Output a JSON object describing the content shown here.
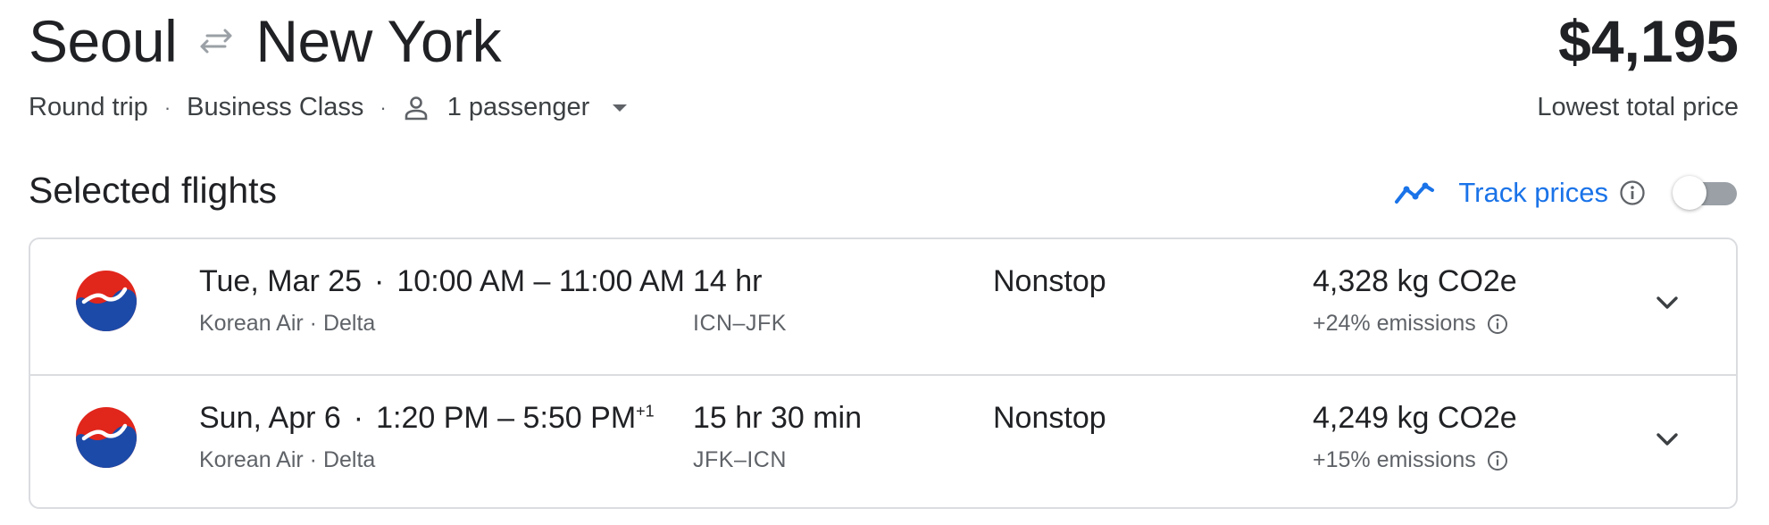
{
  "header": {
    "origin": "Seoul",
    "destination": "New York",
    "total_price": "$4,195",
    "price_caption": "Lowest total price",
    "trip_type": "Round trip",
    "cabin_class": "Business Class",
    "passengers": "1 passenger"
  },
  "section": {
    "title": "Selected flights",
    "track_label": "Track prices",
    "track_enabled": false
  },
  "flights": [
    {
      "date": "Tue, Mar 25",
      "time_range": "10:00 AM – 11:00 AM",
      "day_offset": "",
      "airlines": "Korean Air · Delta",
      "duration": "14 hr",
      "airports": "ICN–JFK",
      "stops": "Nonstop",
      "emissions": "4,328 kg CO2e",
      "emissions_delta": "+24% emissions"
    },
    {
      "date": "Sun, Apr 6",
      "time_range": "1:20 PM – 5:50 PM",
      "day_offset": "+1",
      "airlines": "Korean Air · Delta",
      "duration": "15 hr 30 min",
      "airports": "JFK–ICN",
      "stops": "Nonstop",
      "emissions": "4,249 kg CO2e",
      "emissions_delta": "+15% emissions"
    }
  ],
  "colors": {
    "accent": "#1a73e8",
    "logo_red": "#e1261c",
    "logo_blue": "#1c4aa8"
  },
  "icons": {
    "swap": "swap-arrows-icon",
    "passenger": "person-icon",
    "dropdown": "caret-down-icon",
    "track": "trend-line-icon",
    "info": "info-icon",
    "expand": "chevron-down-icon",
    "airline_logo": "korean-air-logo"
  }
}
